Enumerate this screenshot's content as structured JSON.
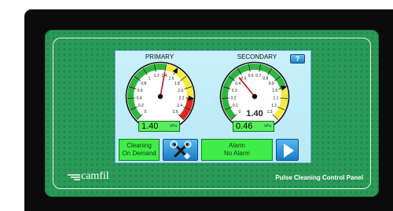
{
  "panel": {
    "brand": "camfil",
    "title": "Pulse Cleaning Control Panel"
  },
  "primary": {
    "label": "PRIMARY",
    "scale": [
      0,
      2.6
    ],
    "ticks": [
      "0",
      "0.2",
      "0.4",
      "0.6",
      "0.8",
      "1",
      "1.2",
      "1.4",
      "1.6",
      "1.8",
      "2.0",
      "2.2",
      "2.4",
      "2.6"
    ],
    "value": 1.4,
    "display": "1.40",
    "unit": "kPa",
    "zones": {
      "green": [
        0,
        1.4
      ],
      "yellow": [
        1.4,
        2.2
      ],
      "red": [
        2.2,
        2.6
      ]
    },
    "markers": [
      1.6,
      2.2
    ]
  },
  "secondary": {
    "label": "SECONDARY",
    "scale": [
      0,
      1.3
    ],
    "ticks": [
      "0",
      "0.1",
      "0.2",
      "0.3",
      "0.4",
      "0.5",
      "0.6",
      "0.7",
      "0.8",
      "0.9",
      "1.0",
      "1.1",
      "1.2",
      "1.3"
    ],
    "value": 0.46,
    "display": "0.46",
    "center_display": "1.40",
    "unit": "kPa",
    "zones": {
      "green": [
        0,
        1.0
      ],
      "yellow": [
        1.0,
        1.3
      ]
    },
    "markers": [
      1.0
    ]
  },
  "buttons": {
    "help": "?",
    "cleaning_line1": "Cleaning",
    "cleaning_line2": "On Demand",
    "alarm_line1": "Alarm",
    "alarm_line2": "No Alarm"
  },
  "icons": {
    "settings": "tools-icon",
    "next": "play-arrow-icon"
  },
  "colors": {
    "panel": "#2a9a58",
    "screen": "#c4eef9",
    "gauge_green": "#31b541",
    "gauge_yellow": "#f4ea3e",
    "gauge_red": "#e0281f",
    "status_green": "#40ec48",
    "button_blue": "#2c8fd6"
  }
}
